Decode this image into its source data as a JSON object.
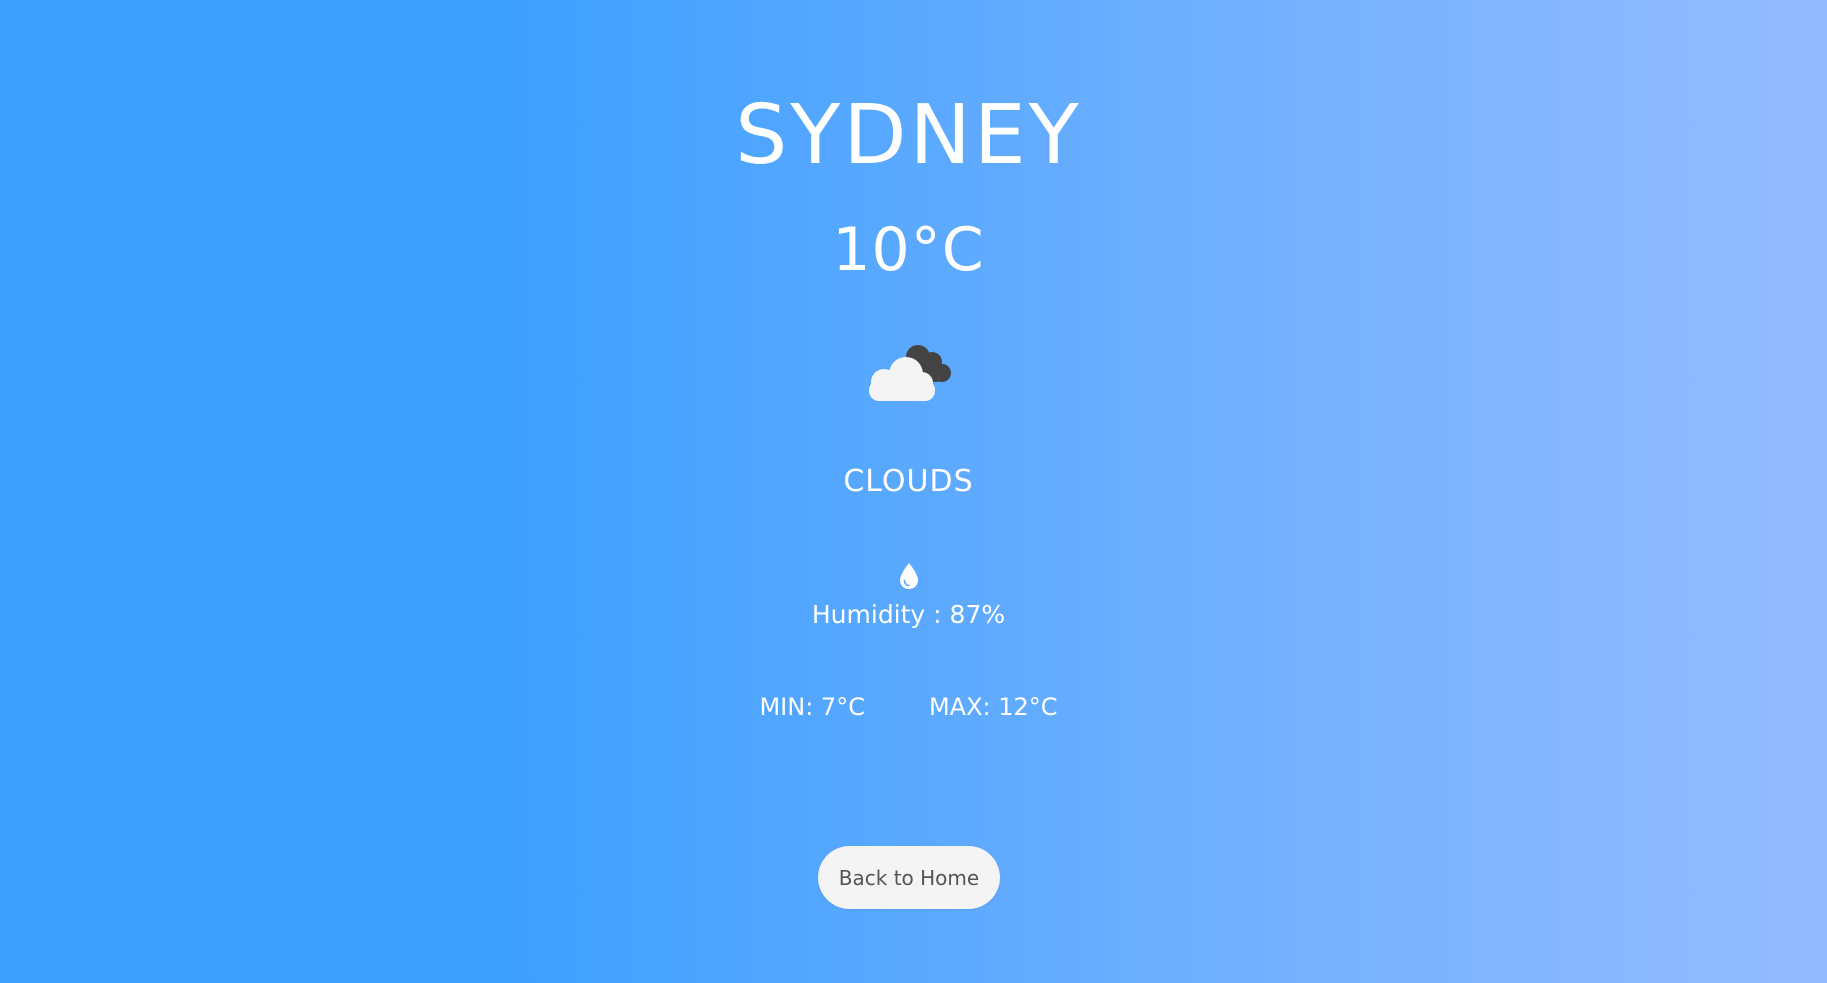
{
  "city": {
    "name": "SYDNEY"
  },
  "weather": {
    "temperature": "10°C",
    "icon": "cloud-icon",
    "condition": "CLOUDS",
    "humidity_icon": "water-drop-icon",
    "humidity": "Humidity : 87%",
    "min": "MIN: 7°C",
    "max": "MAX: 12°C"
  },
  "actions": {
    "back_label": "Back to Home"
  },
  "colors": {
    "background_start": "#3ea0ff",
    "background_end": "#94bbff",
    "text": "#ffffff",
    "cloud_front": "#f4f4f4",
    "cloud_back": "#444444",
    "button_bg": "#f4f4f4",
    "button_text": "#555555"
  }
}
